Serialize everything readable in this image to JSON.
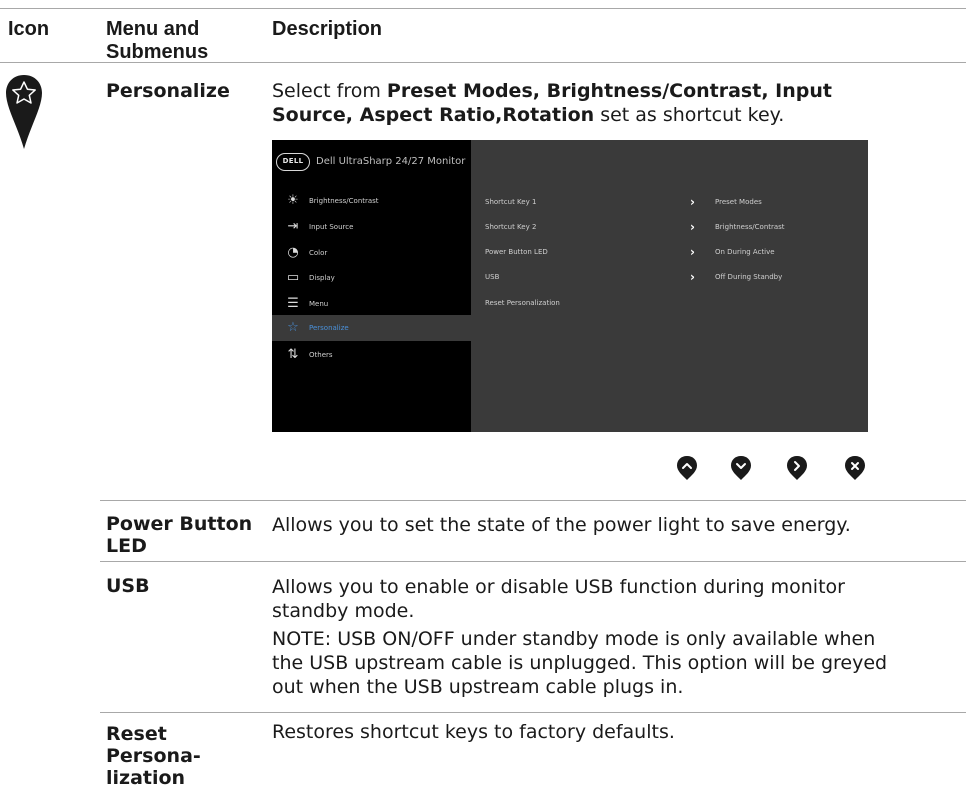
{
  "header": {
    "icon": "Icon",
    "menu_line1": "Menu and",
    "menu_line2": "Submenus",
    "description": "Description"
  },
  "personalize": {
    "icon": "star-icon",
    "name": "Personalize",
    "desc_pre": "Select from ",
    "desc_bold1": "Preset Modes, Brightness/Contrast, Input",
    "desc_bold2": "Source, Aspect Ratio,Rotation",
    "desc_post": " set as shortcut key."
  },
  "osd": {
    "brand": "DELL",
    "title": "Dell UltraSharp 24/27 Monitor",
    "menu": [
      {
        "label": "Brightness/Contrast",
        "icon": "brightness-icon",
        "active": false
      },
      {
        "label": "Input Source",
        "icon": "input-source-icon",
        "active": false
      },
      {
        "label": "Color",
        "icon": "color-icon",
        "active": false
      },
      {
        "label": "Display",
        "icon": "display-icon",
        "active": false
      },
      {
        "label": "Menu",
        "icon": "menu-icon",
        "active": false
      },
      {
        "label": "Personalize",
        "icon": "star-icon",
        "active": true
      },
      {
        "label": "Others",
        "icon": "others-icon",
        "active": false
      }
    ],
    "settings": [
      {
        "label": "Shortcut Key 1",
        "value": "Preset Modes"
      },
      {
        "label": "Shortcut Key 2",
        "value": "Brightness/Contrast"
      },
      {
        "label": "Power Button LED",
        "value": "On During Active"
      },
      {
        "label": "USB",
        "value": "Off During Standby"
      },
      {
        "label": "Reset Personalization",
        "value": ""
      }
    ],
    "accent_color": "#4a90d9"
  },
  "buttons": [
    "up-button-icon",
    "down-button-icon",
    "right-button-icon",
    "close-button-icon"
  ],
  "rows": [
    {
      "name": "Power Button LED",
      "name_line1": "Power Button",
      "name_line2": "LED",
      "desc": "Allows you to set the state of the power light to save energy."
    },
    {
      "name": "USB",
      "desc_line1": "Allows you to enable or disable USB function during monitor",
      "desc_line2": "standby mode.",
      "note_line1": "NOTE: USB ON/OFF under standby mode is only available when",
      "note_line2": "the USB upstream cable is unplugged. This option will be greyed",
      "note_line3": "out when the USB upstream cable plugs in."
    },
    {
      "name_line1": "Reset",
      "name_line2": "Persona-",
      "name_line3": "lization",
      "desc": "Restores shortcut keys to factory defaults."
    }
  ]
}
